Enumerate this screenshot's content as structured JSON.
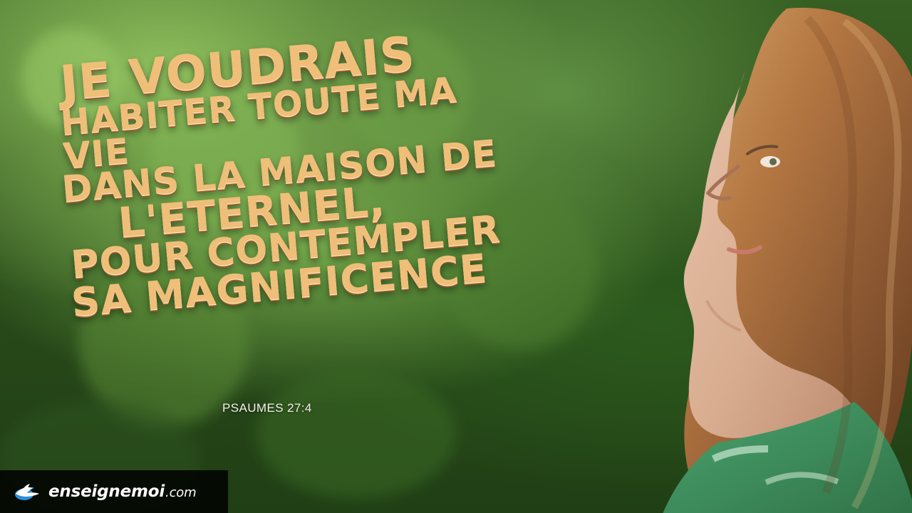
{
  "scene": {
    "background_colors": {
      "forest_light": "#8fc05d",
      "forest_mid": "#5d8d38",
      "forest_dark": "#203f15",
      "text_gold": "#efbe79",
      "brand_bar": "#000000"
    }
  },
  "quote": {
    "lines": [
      "JE VOUDRAIS",
      "HABITER TOUTE MA VIE",
      "DANS LA MAISON DE",
      "L'ETERNEL,",
      "POUR CONTEMPLER",
      "SA MAGNIFICENCE"
    ],
    "reference": "PSAUMES 27:4"
  },
  "brand": {
    "name": "enseignemoi",
    "tld": ".com",
    "icon": "dove-globe-icon"
  }
}
